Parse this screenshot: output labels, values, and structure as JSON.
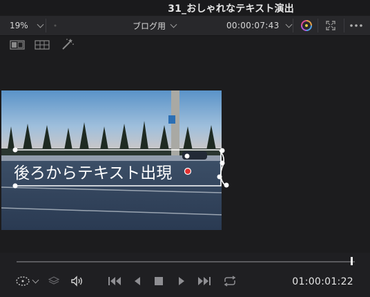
{
  "window": {
    "title": "31_おしゃれなテキスト演出"
  },
  "toolbar": {
    "zoom": "19%",
    "timeline_name": "ブログ用",
    "source_timecode": "00:00:07:43"
  },
  "viewer": {
    "overlay_text": "後ろからテキスト出現"
  },
  "transport": {
    "current_timecode": "01:00:01:22",
    "playhead_fraction": 0.99
  }
}
